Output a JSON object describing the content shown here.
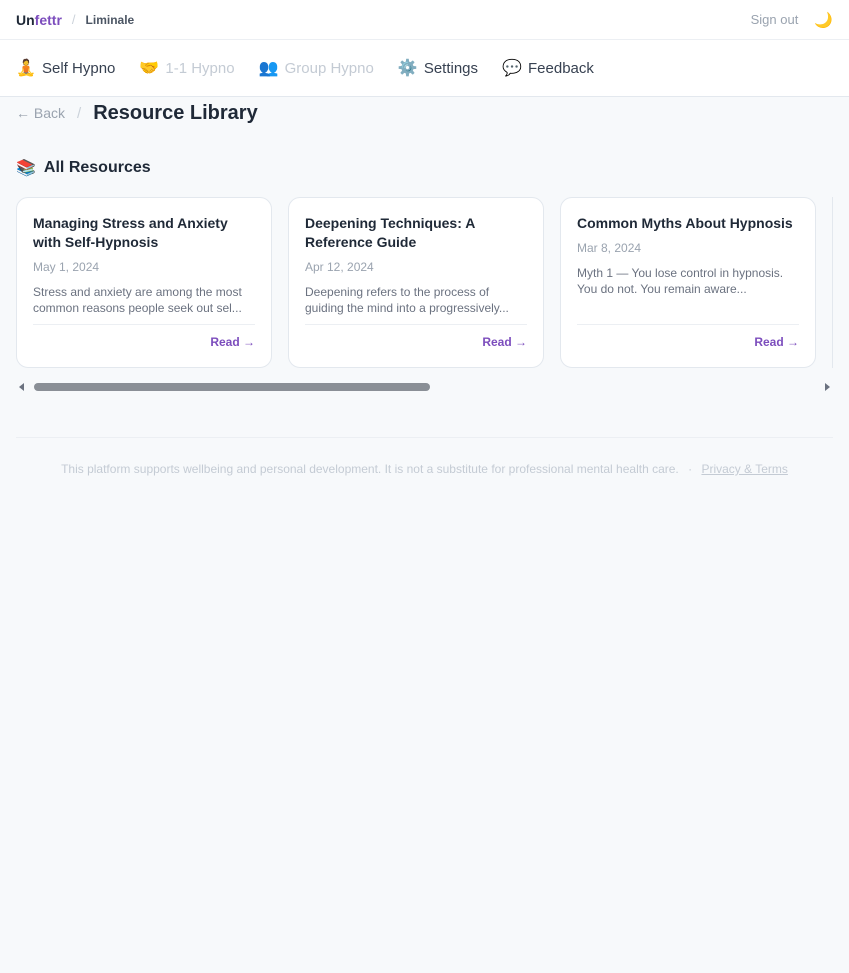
{
  "topbar": {
    "brand_un": "Un",
    "brand_fettr": "fettr",
    "separator": "/",
    "org": "Liminale",
    "signout": "Sign out",
    "moon_icon": "🌙"
  },
  "nav": {
    "items": [
      {
        "icon": "🧘",
        "label": "Self Hypno"
      },
      {
        "icon": "🤝",
        "label": "1-1 Hypno"
      },
      {
        "icon": "👥",
        "label": "Group Hypno"
      },
      {
        "icon": "⚙️",
        "label": "Settings"
      },
      {
        "icon": "💬",
        "label": "Feedback"
      }
    ]
  },
  "breadcrumb": {
    "back": "← Back",
    "separator": "/",
    "title": "Resource Library"
  },
  "section": {
    "icon": "📚",
    "label": "All Resources"
  },
  "resources": [
    {
      "title": "Managing Stress and Anxiety with Self-Hypnosis",
      "date": "May 1, 2024",
      "excerpt": "Stress and anxiety are among the most common reasons people seek out sel...",
      "read": "Read →"
    },
    {
      "title": "Deepening Techniques: A Reference Guide",
      "date": "Apr 12, 2024",
      "excerpt": "Deepening refers to the process of guiding the mind into a progressively...",
      "read": "Read →"
    },
    {
      "title": "Common Myths About Hypnosis",
      "date": "Mar 8, 2024",
      "excerpt": "Myth 1 — You lose control in hypnosis. You do not. You remain aware...",
      "read": "Read →"
    }
  ],
  "footer": {
    "disclaimer": "This platform supports wellbeing and personal development. It is not a substitute for professional mental health care.",
    "dot": "·",
    "terms": "Privacy & Terms"
  },
  "colors": {
    "accent": "#7c4dbd",
    "background": "#f7f9fb"
  }
}
